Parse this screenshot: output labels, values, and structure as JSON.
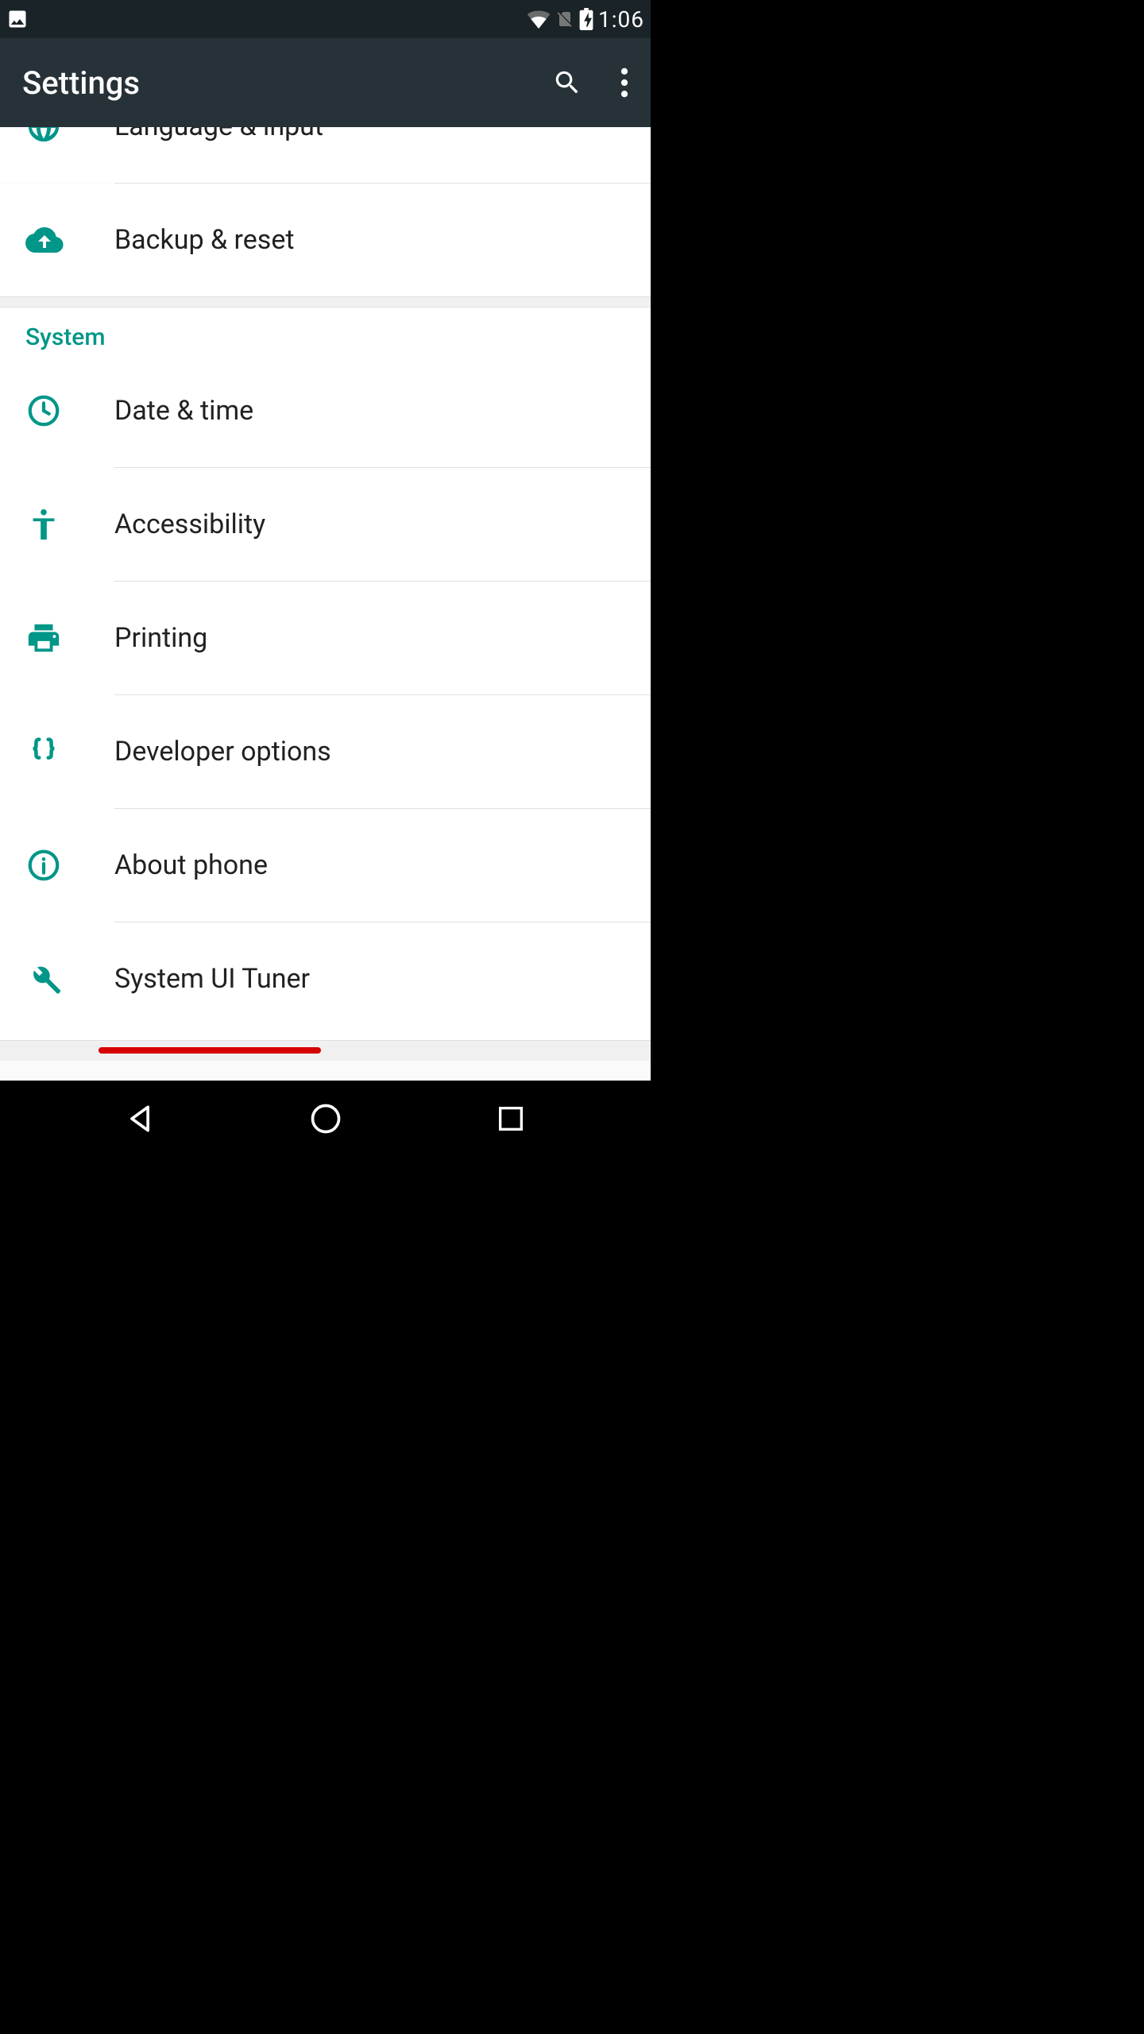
{
  "status": {
    "time": "1:06"
  },
  "appbar": {
    "title": "Settings"
  },
  "partial": {
    "language": "Language & input"
  },
  "personal": {
    "backup": "Backup & reset"
  },
  "system_header": "System",
  "system": {
    "date_time": "Date & time",
    "accessibility": "Accessibility",
    "printing": "Printing",
    "developer": "Developer options",
    "about": "About phone",
    "ui_tuner": "System UI Tuner"
  },
  "colors": {
    "accent": "#009688",
    "appbar": "#263238",
    "status": "#1a2327",
    "highlight": "#d50000"
  }
}
